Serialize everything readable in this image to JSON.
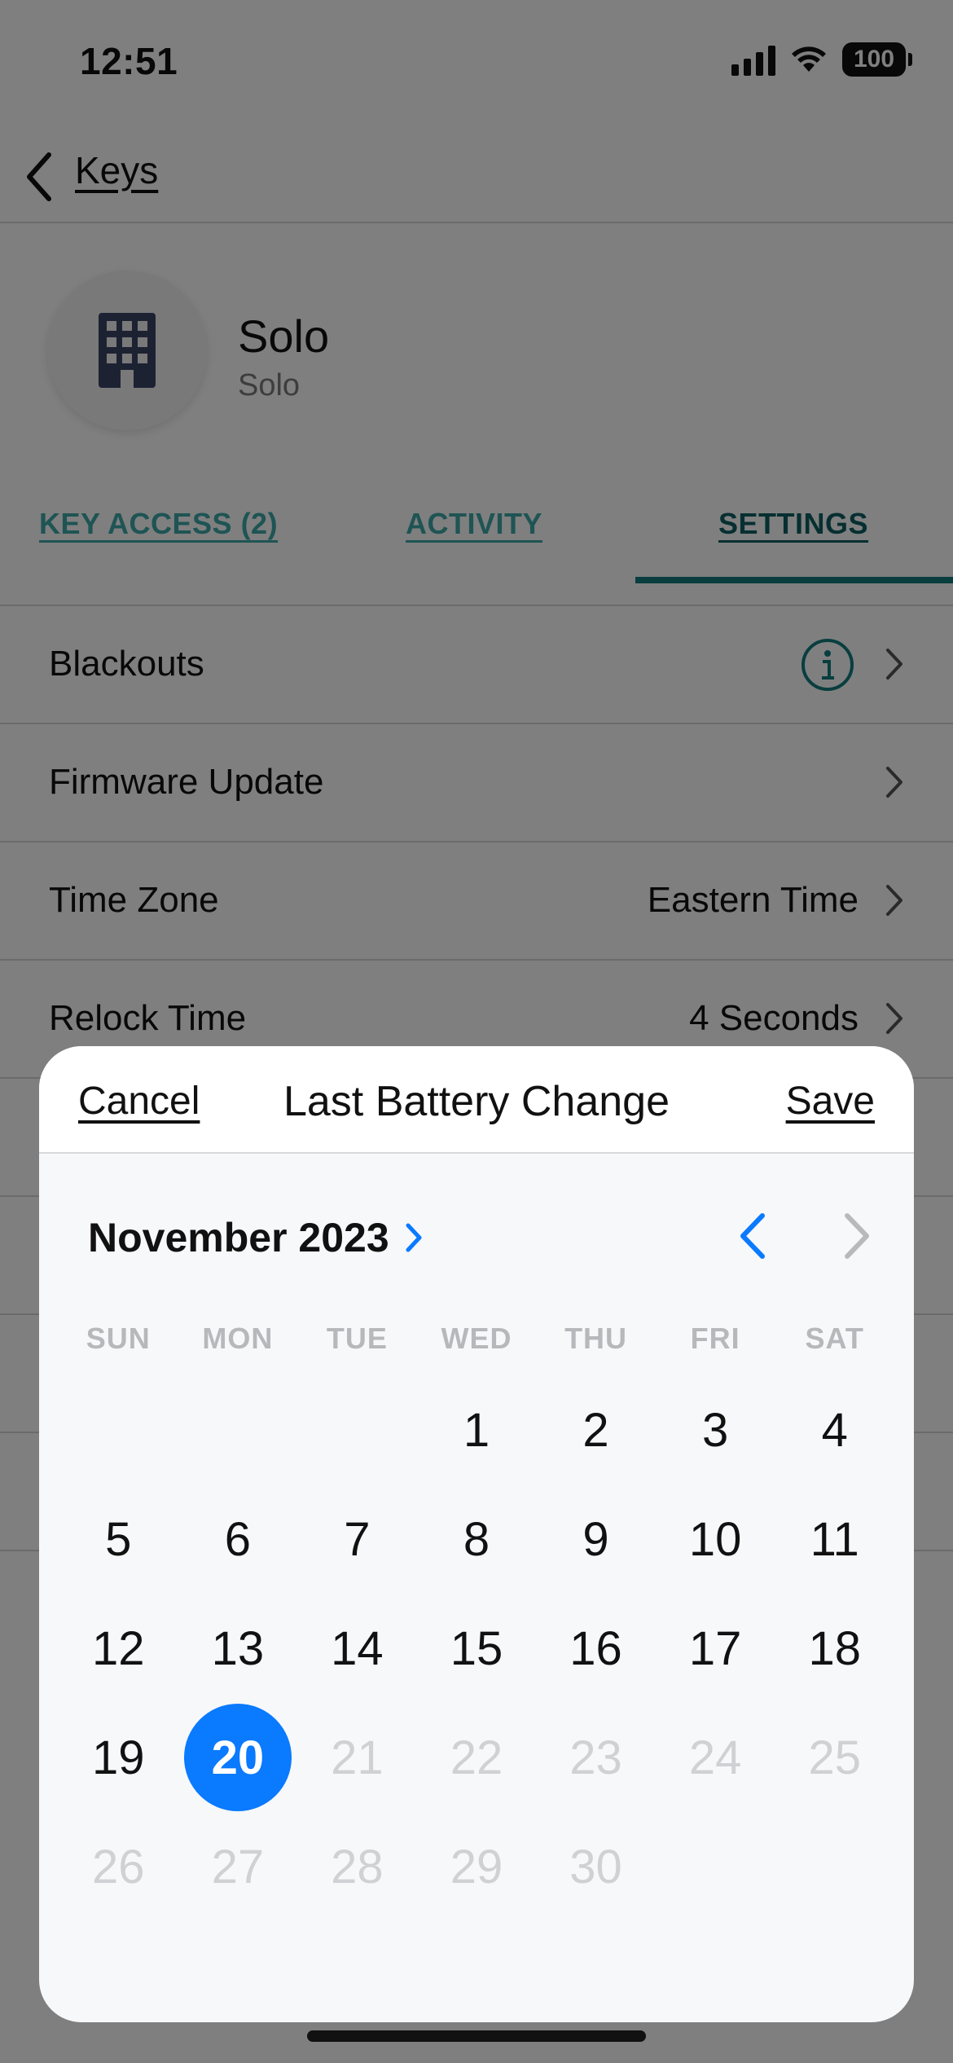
{
  "status_bar": {
    "time": "12:51",
    "battery": "100"
  },
  "nav": {
    "back_label": "Keys"
  },
  "profile": {
    "name": "Solo",
    "subtitle": "Solo"
  },
  "tabs": [
    {
      "label": "KEY ACCESS (2)"
    },
    {
      "label": "ACTIVITY"
    },
    {
      "label": "SETTINGS",
      "active": true
    }
  ],
  "settings": {
    "rows": [
      {
        "label": "Blackouts",
        "value": ""
      },
      {
        "label": "Firmware Update",
        "value": ""
      },
      {
        "label": "Time Zone",
        "value": "Eastern Time"
      },
      {
        "label": "Relock Time",
        "value": "4 Seconds"
      }
    ]
  },
  "sheet": {
    "cancel_label": "Cancel",
    "title": "Last Battery Change",
    "save_label": "Save"
  },
  "calendar": {
    "month_label": "November 2023",
    "weekdays": [
      "SUN",
      "MON",
      "TUE",
      "WED",
      "THU",
      "FRI",
      "SAT"
    ],
    "leading_blank_days": 3,
    "days": [
      "1",
      "2",
      "3",
      "4",
      "5",
      "6",
      "7",
      "8",
      "9",
      "10",
      "11",
      "12",
      "13",
      "14",
      "15",
      "16",
      "17",
      "18",
      "19",
      "20",
      "21",
      "22",
      "23",
      "24",
      "25",
      "26",
      "27",
      "28",
      "29",
      "30"
    ],
    "selected_day": "20",
    "disabled_from_day": "21"
  },
  "colors": {
    "accent_teal": "#127c7e",
    "selected_blue": "#0a7aff",
    "disabled_day": "#d0d1d4"
  },
  "icons": {
    "avatar": "building-icon",
    "back": "chevron-left-icon",
    "row": "chevron-right-icon",
    "info": "info-icon"
  }
}
